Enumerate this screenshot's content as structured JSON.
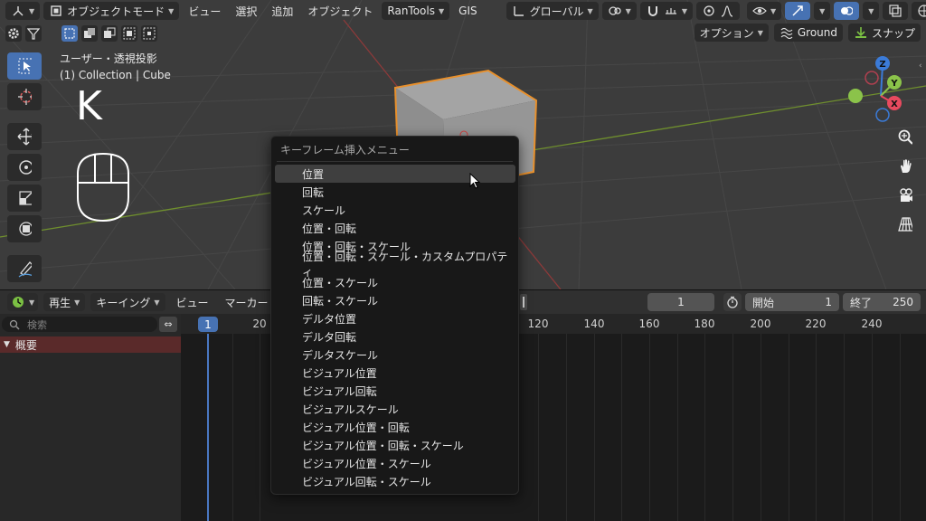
{
  "header": {
    "mode_label": "オブジェクトモード",
    "menus": [
      "ビュー",
      "選択",
      "追加",
      "オブジェクト"
    ],
    "addon_label": "RanTools",
    "gis_label": "GIS",
    "orientation_label": "グローバル"
  },
  "subheader": {
    "options_label": "オプション",
    "ground_label": "Ground",
    "snap_label": "スナップ"
  },
  "viewport": {
    "view_name": "ユーザー・透視投影",
    "context": "(1) Collection | Cube",
    "key_pressed": "K",
    "gizmo": {
      "z": "Z",
      "y": "Y",
      "x": "X"
    },
    "colors": {
      "selection_outline": "#e8902c",
      "x_axis": "#e84a5f",
      "y_axis": "#8bc34a",
      "z_axis": "#3b7bd8"
    }
  },
  "timeline": {
    "playback_label": "再生",
    "keying_label": "キーイング",
    "view_label": "ビュー",
    "marker_label": "マーカー",
    "current_frame": "1",
    "start_label": "開始",
    "start_value": "1",
    "end_label": "終了",
    "end_value": "250",
    "search_placeholder": "検索",
    "summary_label": "概要",
    "cursor_frame": "1",
    "ruler_ticks": [
      "20",
      "120",
      "140",
      "160",
      "180",
      "200",
      "220",
      "240"
    ]
  },
  "popup": {
    "title": "キーフレーム挿入メニュー",
    "items": [
      "位置",
      "回転",
      "スケール",
      "位置・回転",
      "位置・回転・スケール",
      "位置・回転・スケール・カスタムプロパティ",
      "位置・スケール",
      "回転・スケール",
      "デルタ位置",
      "デルタ回転",
      "デルタスケール",
      "ビジュアル位置",
      "ビジュアル回転",
      "ビジュアルスケール",
      "ビジュアル位置・回転",
      "ビジュアル位置・回転・スケール",
      "ビジュアル位置・スケール",
      "ビジュアル回転・スケール"
    ],
    "highlighted_index": 0
  }
}
